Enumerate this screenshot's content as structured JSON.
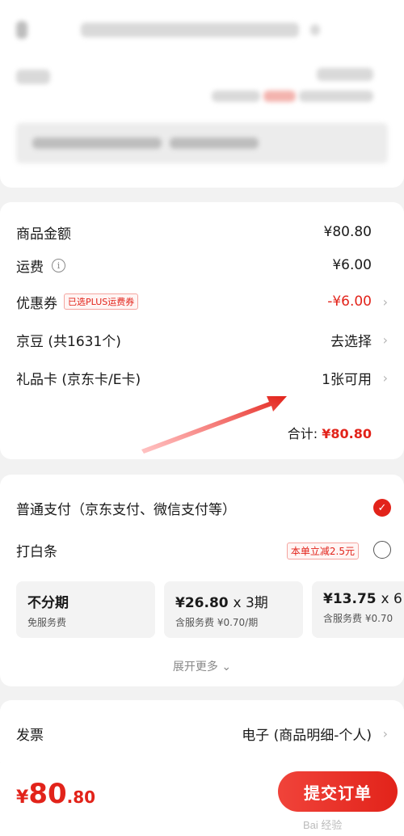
{
  "price_section": {
    "goods_label": "商品金额",
    "goods_value": "¥80.80",
    "shipping_label": "运费",
    "shipping_info_glyph": "i",
    "shipping_value": "¥6.00",
    "coupon_label": "优惠券",
    "coupon_tag": "已选PLUS运费券",
    "coupon_value": "-¥6.00",
    "beans_label": "京豆 (共1631个)",
    "beans_value": "去选择",
    "giftcard_label": "礼品卡 (京东卡/E卡)",
    "giftcard_value": "1张可用",
    "total_label": "合计:",
    "total_value": "¥80.80",
    "chevron": "›"
  },
  "payment": {
    "normal_label": "普通支付（京东支付、微信支付等）",
    "baitiao_label": "打白条",
    "baitiao_badge": "本单立减2.5元",
    "check_mark": "✓",
    "plans": [
      {
        "title": "不分期",
        "sub": "免服务费"
      },
      {
        "title": "¥26.80",
        "times": "x 3期",
        "sub": "含服务费 ¥0.70/期"
      },
      {
        "title": "¥13.75",
        "times": "x 6",
        "sub": "含服务费 ¥0.70"
      }
    ],
    "expand_label": "展开更多 ⌄"
  },
  "invoice": {
    "label": "发票",
    "value": "电子 (商品明细-个人)",
    "chevron": "›"
  },
  "bottom_bar": {
    "price_symbol": "¥",
    "price_int": "80",
    "price_dec": ".80",
    "submit_label": "提交订单",
    "watermark": "Bai 经验"
  },
  "colors": {
    "accent": "#e2231a",
    "background": "#f2f2f2"
  },
  "icons": [
    "back-icon",
    "info-icon",
    "chevron-right-icon",
    "checkmark-icon",
    "chevron-down-icon",
    "arrow-annotation"
  ]
}
